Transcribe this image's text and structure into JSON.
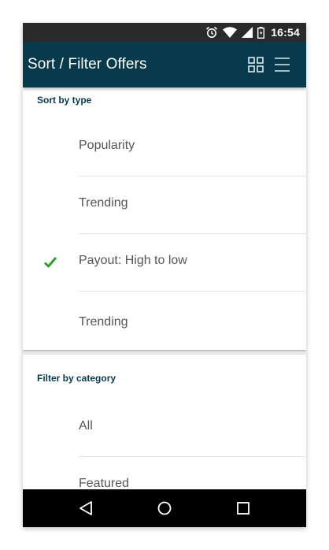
{
  "status_bar": {
    "time": "16:54",
    "icons": [
      "alarm-icon",
      "wifi-icon",
      "signal-icon",
      "battery-icon"
    ]
  },
  "app_bar": {
    "title": "Sort / Filter Offers",
    "actions": [
      "grid-view-icon",
      "list-view-icon"
    ],
    "background_color": "#073b4c"
  },
  "sort_section": {
    "header": "Sort by type",
    "options": [
      {
        "label": "Popularity",
        "selected": false
      },
      {
        "label": "Trending",
        "selected": false
      },
      {
        "label": "Payout: High to low",
        "selected": true
      },
      {
        "label": "Trending",
        "selected": false
      }
    ]
  },
  "filter_section": {
    "header": "Filter by category",
    "options": [
      {
        "label": "All",
        "selected": false
      },
      {
        "label": "Featured",
        "selected": false
      }
    ]
  },
  "nav_bar": {
    "buttons": [
      "back-icon",
      "home-icon",
      "recents-icon"
    ]
  },
  "colors": {
    "accent_check": "#2e9e2e",
    "section_header": "#073b4c"
  }
}
